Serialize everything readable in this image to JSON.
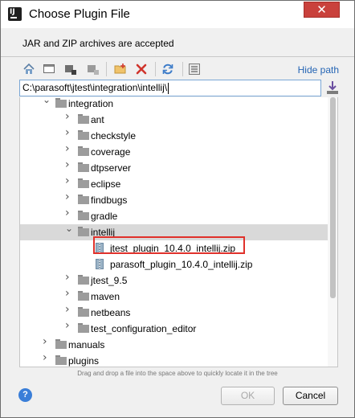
{
  "window": {
    "title": "Choose Plugin File",
    "app_icon_letters": "IJ",
    "close_glyph": "✕"
  },
  "subtitle": "JAR and ZIP archives are accepted",
  "toolbar": {
    "icons": [
      "home-icon",
      "desktop-icon",
      "project-icon",
      "module-icon",
      "new-folder-icon",
      "delete-icon",
      "refresh-icon",
      "show-hidden-icon"
    ],
    "hide_path_label": "Hide path"
  },
  "path": {
    "value": "C:\\parasoft\\jtest\\integration\\intellij\\"
  },
  "tree": {
    "rows": [
      {
        "label": "integration",
        "type": "folder",
        "depth": 0,
        "expanded": true
      },
      {
        "label": "ant",
        "type": "folder",
        "depth": 1,
        "expanded": false
      },
      {
        "label": "checkstyle",
        "type": "folder",
        "depth": 1,
        "expanded": false
      },
      {
        "label": "coverage",
        "type": "folder",
        "depth": 1,
        "expanded": false
      },
      {
        "label": "dtpserver",
        "type": "folder",
        "depth": 1,
        "expanded": false
      },
      {
        "label": "eclipse",
        "type": "folder",
        "depth": 1,
        "expanded": false
      },
      {
        "label": "findbugs",
        "type": "folder",
        "depth": 1,
        "expanded": false
      },
      {
        "label": "gradle",
        "type": "folder",
        "depth": 1,
        "expanded": false
      },
      {
        "label": "intellij",
        "type": "folder",
        "depth": 1,
        "expanded": true,
        "selected": true
      },
      {
        "label": "jtest_plugin_10.4.0_intellij.zip",
        "type": "zip",
        "depth": 2,
        "highlighted": true
      },
      {
        "label": "parasoft_plugin_10.4.0_intellij.zip",
        "type": "zip",
        "depth": 2
      },
      {
        "label": "jtest_9.5",
        "type": "folder",
        "depth": 1,
        "expanded": false
      },
      {
        "label": "maven",
        "type": "folder",
        "depth": 1,
        "expanded": false
      },
      {
        "label": "netbeans",
        "type": "folder",
        "depth": 1,
        "expanded": false
      },
      {
        "label": "test_configuration_editor",
        "type": "folder",
        "depth": 1,
        "expanded": false
      },
      {
        "label": "manuals",
        "type": "folder",
        "depth": 0,
        "expanded": false
      },
      {
        "label": "plugins",
        "type": "folder",
        "depth": 0,
        "expanded": false
      }
    ]
  },
  "hint": "Drag and drop a file into the space above to quickly locate it in the tree",
  "buttons": {
    "help": "?",
    "ok": "OK",
    "cancel": "Cancel"
  }
}
